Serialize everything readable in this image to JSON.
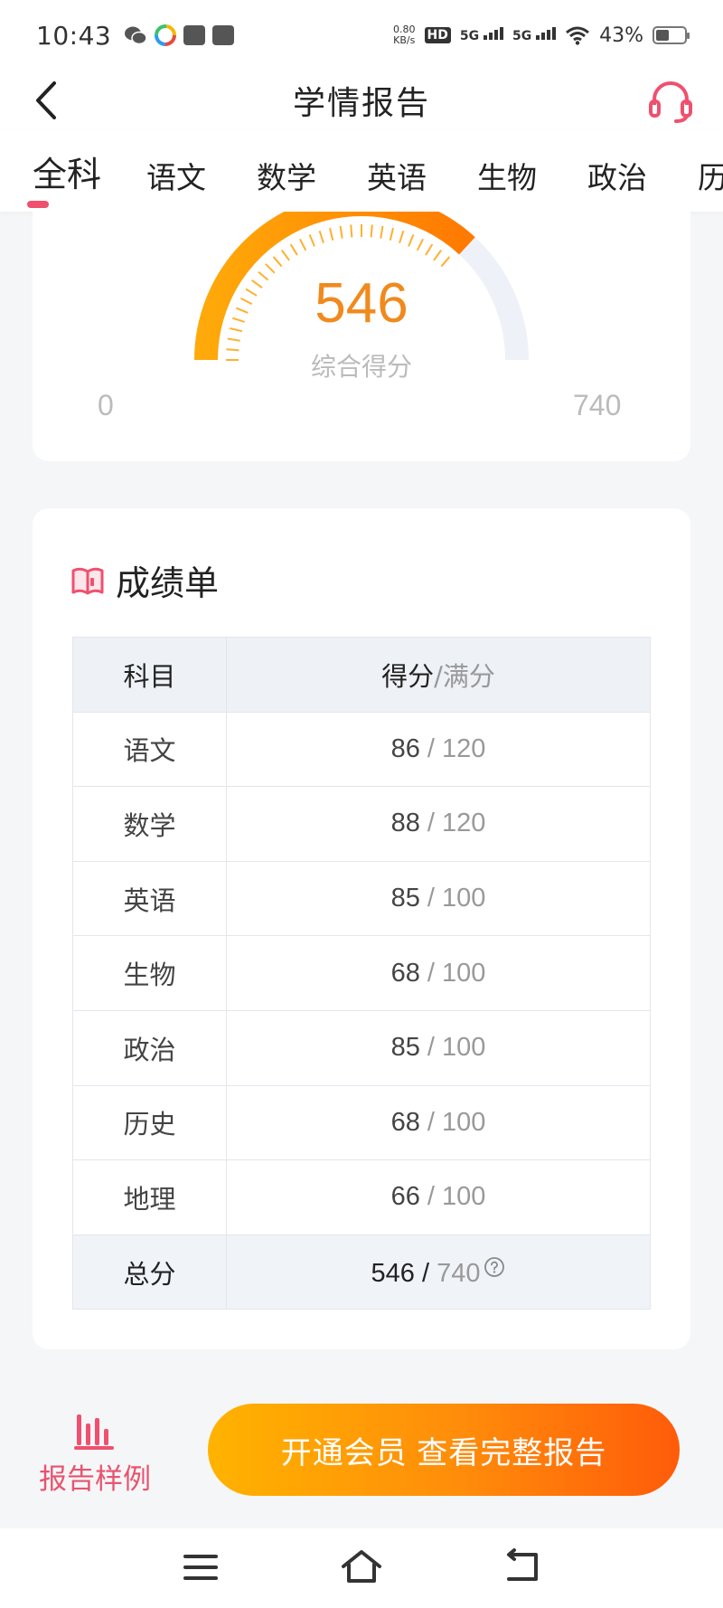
{
  "status_bar": {
    "time": "10:43",
    "speed_value": "0.80",
    "speed_unit": "KB/s",
    "hd": "HD",
    "net1": "5G",
    "net2": "5G",
    "battery": "43%"
  },
  "nav": {
    "title": "学情报告"
  },
  "tabs": [
    {
      "label": "全科",
      "active": true
    },
    {
      "label": "语文"
    },
    {
      "label": "数学"
    },
    {
      "label": "英语"
    },
    {
      "label": "生物"
    },
    {
      "label": "政治"
    },
    {
      "label": "历"
    }
  ],
  "score_card": {
    "score": "546",
    "label": "综合得分",
    "min": "0",
    "max": "740",
    "fraction": 0.7378
  },
  "report": {
    "title": "成绩单",
    "columns": {
      "subject": "科目",
      "score": "得分",
      "full": "满分"
    },
    "rows": [
      {
        "subject": "语文",
        "score": "86",
        "full": "120"
      },
      {
        "subject": "数学",
        "score": "88",
        "full": "120"
      },
      {
        "subject": "英语",
        "score": "85",
        "full": "100"
      },
      {
        "subject": "生物",
        "score": "68",
        "full": "100"
      },
      {
        "subject": "政治",
        "score": "85",
        "full": "100"
      },
      {
        "subject": "历史",
        "score": "68",
        "full": "100"
      },
      {
        "subject": "地理",
        "score": "66",
        "full": "100"
      }
    ],
    "total": {
      "subject": "总分",
      "score": "546",
      "full": "740"
    }
  },
  "bottom": {
    "sample_label": "报告样例",
    "vip_label": "开通会员 查看完整报告"
  },
  "colors": {
    "accent": "#f0506e",
    "orange": "#f08a1c",
    "gauge_track": "#eef2f8"
  }
}
